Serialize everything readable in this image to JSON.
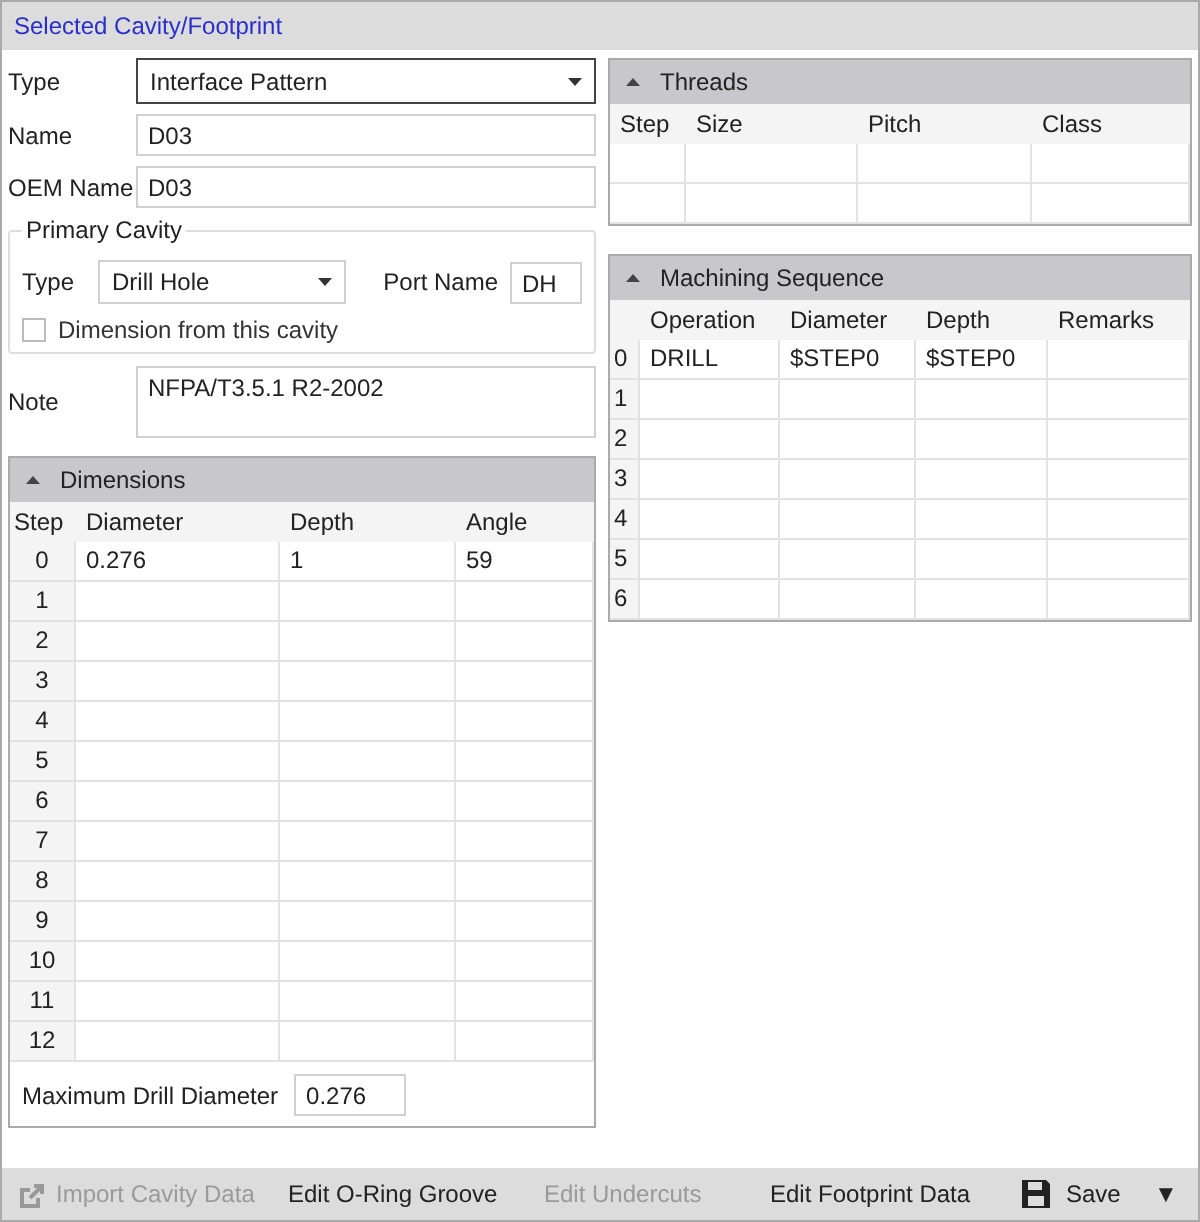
{
  "title": "Selected Cavity/Footprint",
  "form": {
    "type_label": "Type",
    "type_value": "Interface Pattern",
    "name_label": "Name",
    "name_value": "D03",
    "oem_label": "OEM Name",
    "oem_value": "D03",
    "note_label": "Note",
    "note_value": "NFPA/T3.5.1 R2-2002"
  },
  "primary_cavity": {
    "legend": "Primary Cavity",
    "type_label": "Type",
    "type_value": "Drill Hole",
    "port_label": "Port Name",
    "port_value": "DH",
    "checkbox_label": "Dimension from this cavity",
    "checked": false
  },
  "dimensions": {
    "title": "Dimensions",
    "expanded": true,
    "columns": [
      "Step",
      "Diameter",
      "Depth",
      "Angle"
    ],
    "rows": [
      {
        "step": "0",
        "cells": [
          "0.276",
          "1",
          "59"
        ]
      },
      {
        "step": "1"
      },
      {
        "step": "2"
      },
      {
        "step": "3"
      },
      {
        "step": "4"
      },
      {
        "step": "5"
      },
      {
        "step": "6"
      },
      {
        "step": "7"
      },
      {
        "step": "8"
      },
      {
        "step": "9"
      },
      {
        "step": "10"
      },
      {
        "step": "11"
      },
      {
        "step": "12"
      }
    ],
    "max_label": "Maximum Drill Diameter",
    "max_value": "0.276"
  },
  "threads": {
    "title": "Threads",
    "expanded": true,
    "columns": [
      "Step",
      "Size",
      "Pitch",
      "Class"
    ]
  },
  "machining": {
    "title": "Machining Sequence",
    "expanded": true,
    "columns": [
      "",
      "Operation",
      "Diameter",
      "Depth",
      "Remarks"
    ],
    "rows": [
      {
        "step": "0",
        "cells": [
          "DRILL",
          "$STEP0",
          "$STEP0"
        ]
      },
      {
        "step": "1"
      },
      {
        "step": "2"
      },
      {
        "step": "3"
      },
      {
        "step": "4"
      },
      {
        "step": "5"
      },
      {
        "step": "6"
      }
    ]
  },
  "toolbar": [
    {
      "label": "Import Cavity Data",
      "kind": "import",
      "disabled": true
    },
    {
      "label": "Edit O-Ring Groove",
      "kind": "plain",
      "disabled": false
    },
    {
      "label": "Edit Undercuts",
      "kind": "plain",
      "disabled": true
    },
    {
      "label": "Edit Footprint Data",
      "kind": "plain",
      "disabled": false
    },
    {
      "label": "Save",
      "kind": "save",
      "disabled": false
    },
    {
      "label": "▼",
      "kind": "more",
      "disabled": false
    }
  ]
}
